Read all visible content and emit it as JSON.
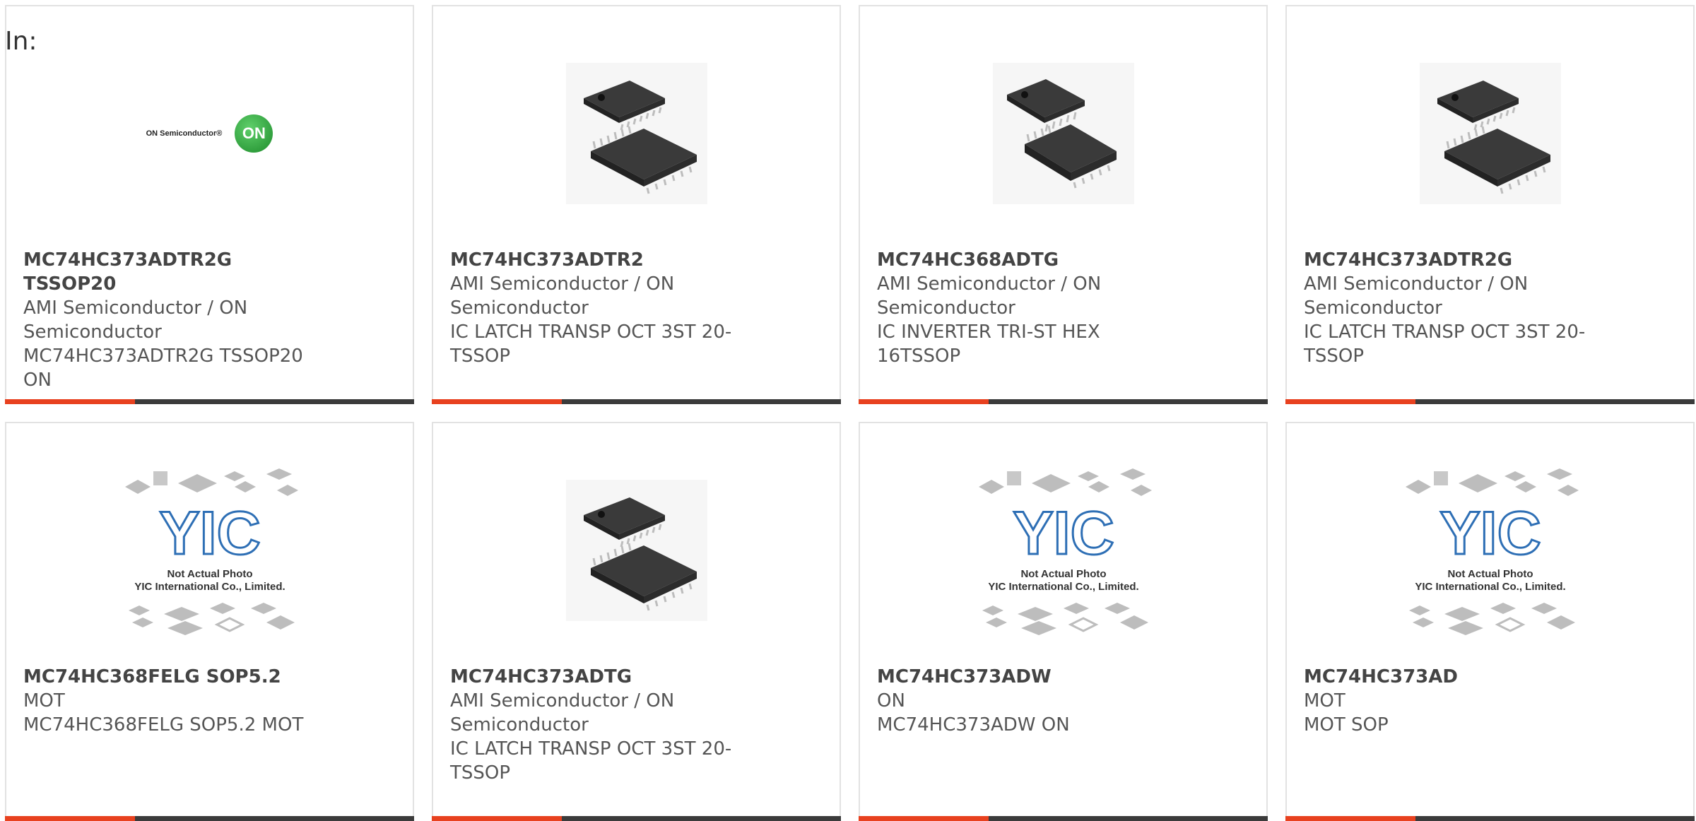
{
  "header": {
    "in_label": "In:"
  },
  "colors": {
    "accent": "#e8411f",
    "bar": "#3b3b3b",
    "text": "#555555"
  },
  "products": [
    {
      "part_number": "MC74HC373ADTR2G TSSOP20",
      "manufacturer": "AMI Semiconductor / ON Semiconductor",
      "description": "MC74HC373ADTR2G TSSOP20 ON",
      "image": "on-semiconductor-logo",
      "logo_text": "ON Semiconductor®",
      "logo_mark": "ON"
    },
    {
      "part_number": "MC74HC373ADTR2",
      "manufacturer": "AMI Semiconductor / ON Semiconductor",
      "description": "IC LATCH TRANSP OCT 3ST 20-TSSOP",
      "image": "tssop-chip-photo"
    },
    {
      "part_number": "MC74HC368ADTG",
      "manufacturer": "AMI Semiconductor / ON Semiconductor",
      "description": "IC INVERTER TRI-ST HEX 16TSSOP",
      "image": "tssop-chip-photo-alt"
    },
    {
      "part_number": "MC74HC373ADTR2G",
      "manufacturer": "AMI Semiconductor / ON Semiconductor",
      "description": "IC LATCH TRANSP OCT 3ST 20-TSSOP",
      "image": "tssop-chip-photo"
    },
    {
      "part_number": "MC74HC368FELG SOP5.2",
      "manufacturer": "MOT",
      "description": "MC74HC368FELG SOP5.2 MOT",
      "image": "yic-placeholder",
      "placeholder_line1": "Not Actual Photo",
      "placeholder_line2": "YIC International Co., Limited."
    },
    {
      "part_number": "MC74HC373ADTG",
      "manufacturer": "AMI Semiconductor / ON Semiconductor",
      "description": "IC LATCH TRANSP OCT 3ST 20-TSSOP",
      "image": "tssop-chip-photo"
    },
    {
      "part_number": "MC74HC373ADW",
      "manufacturer": "ON",
      "description": "MC74HC373ADW ON",
      "image": "yic-placeholder",
      "placeholder_line1": "Not Actual Photo",
      "placeholder_line2": "YIC International Co., Limited."
    },
    {
      "part_number": "MC74HC373AD",
      "manufacturer": "MOT",
      "description": "MOT SOP",
      "image": "yic-placeholder",
      "placeholder_line1": "Not Actual Photo",
      "placeholder_line2": "YIC International Co., Limited."
    }
  ]
}
